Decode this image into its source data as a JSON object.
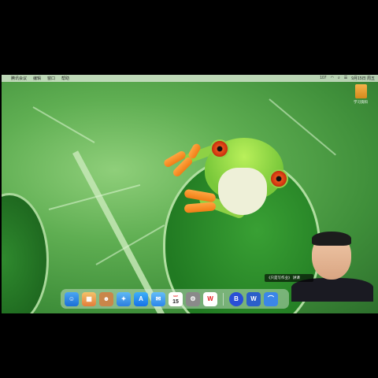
{
  "menubar": {
    "apple_glyph": "",
    "app_name": "腾讯会议",
    "menus": [
      "编辑",
      "窗口",
      "帮助"
    ],
    "status": [
      "107",
      "",
      "",
      "",
      "",
      "",
      "9月15日 周五"
    ]
  },
  "desktop": {
    "file_label": "学习资料"
  },
  "dock": {
    "calendar_month": "SEP",
    "calendar_day": "15"
  },
  "webcam": {
    "caption": "《只是写作业》 讲课"
  },
  "colors": {
    "leaf": "#5fae52",
    "frog_green": "#8ed145",
    "frog_eye": "#e8541c",
    "frog_toes": "#f07d16"
  }
}
